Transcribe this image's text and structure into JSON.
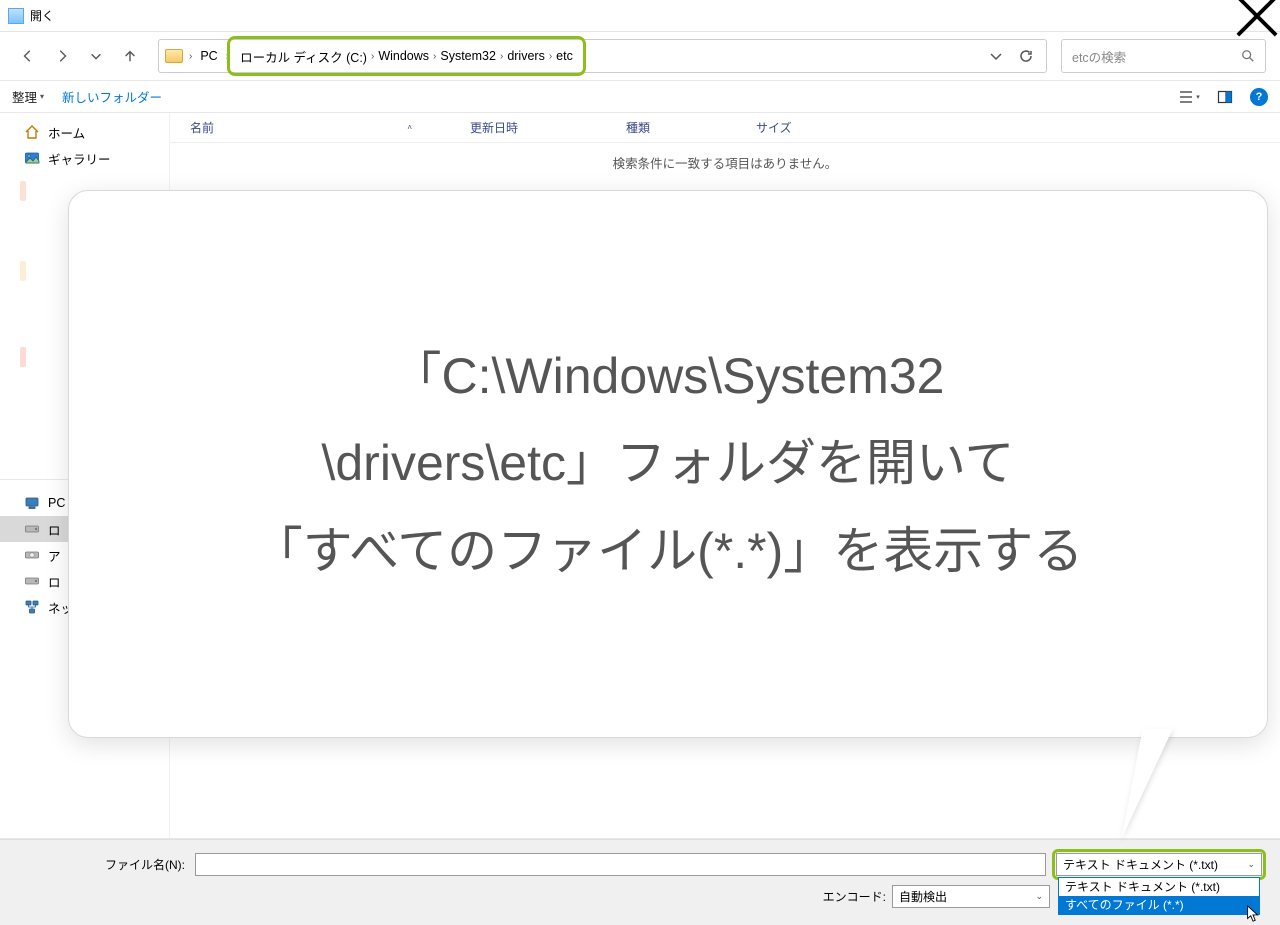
{
  "window": {
    "title": "開く"
  },
  "breadcrumb": {
    "pc": "PC",
    "items": [
      "ローカル ディスク (C:)",
      "Windows",
      "System32",
      "drivers",
      "etc"
    ]
  },
  "search": {
    "placeholder": "etcの検索"
  },
  "toolbar": {
    "organize": "整理",
    "new_folder": "新しいフォルダー"
  },
  "sidebar": {
    "home": "ホーム",
    "gallery": "ギャラリー",
    "pc": "PC",
    "drive_c_short": "ロ",
    "drive_a_short": "ア",
    "drive_d_short": "ロ",
    "network_short": "ネッ"
  },
  "columns": {
    "name": "名前",
    "date": "更新日時",
    "type": "種類",
    "size": "サイズ"
  },
  "content": {
    "empty": "検索条件に一致する項目はありません。"
  },
  "bubble": {
    "text": "「C:\\Windows\\System32\n\\drivers\\etc」フォルダを開いて\n「すべてのファイル(*.*)」を表示する"
  },
  "bottom": {
    "filename_label": "ファイル名(N):",
    "filename_value": "",
    "encoding_label": "エンコード:",
    "encoding_value": "自動検出",
    "filetype_selected": "テキスト ドキュメント (*.txt)",
    "filetype_options": {
      "txt": "テキスト ドキュメント (*.txt)",
      "all": "すべてのファイル  (*.*)"
    }
  }
}
